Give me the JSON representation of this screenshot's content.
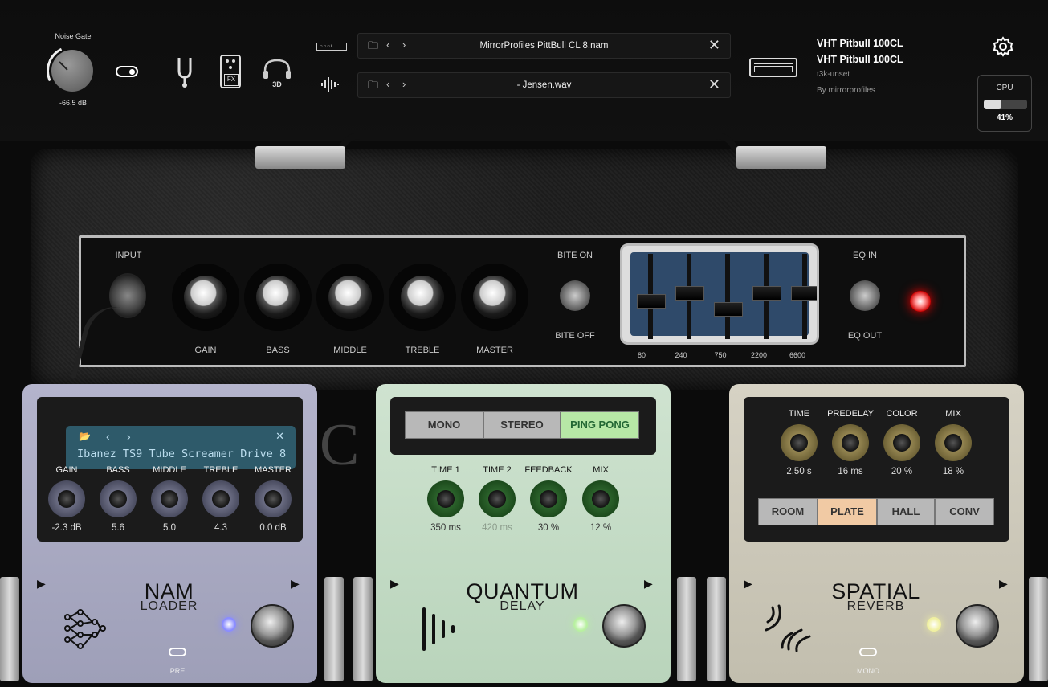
{
  "topbar": {
    "noise_gate": {
      "label": "Noise Gate",
      "value": "-66.5 dB"
    },
    "input_file": {
      "name": "MirrorProfiles PittBull CL 8.nam"
    },
    "ir_file": {
      "name": "- Jensen.wav"
    },
    "amp_info": {
      "title1": "VHT Pitbull 100CL",
      "title2": "VHT Pitbull 100CL",
      "line3": "t3k-unset",
      "line4": "By mirrorprofiles"
    },
    "three_d_label": "3D",
    "fx_label": "FX",
    "cpu": {
      "label": "CPU",
      "value": "41%",
      "fraction": 0.41
    }
  },
  "amp": {
    "input_label": "INPUT",
    "knobs": [
      "GAIN",
      "BASS",
      "MIDDLE",
      "TREBLE",
      "MASTER"
    ],
    "bite_on": "BITE ON",
    "bite_off": "BITE OFF",
    "eq_in": "EQ IN",
    "eq_out": "EQ OUT",
    "eq_freqs": [
      "80",
      "240",
      "750",
      "2200",
      "6600"
    ],
    "brand_partial": "C"
  },
  "pedals": {
    "nam": {
      "lcd": "Ibanez TS9 Tube Screamer Drive 8",
      "knobs": [
        {
          "label": "GAIN",
          "value": "-2.3 dB"
        },
        {
          "label": "BASS",
          "value": "5.6"
        },
        {
          "label": "MIDDLE",
          "value": "5.0"
        },
        {
          "label": "TREBLE",
          "value": "4.3"
        },
        {
          "label": "MASTER",
          "value": "0.0 dB"
        }
      ],
      "title": "NAM",
      "subtitle": "LOADER",
      "toggle_label": "PRE",
      "led_color": "#8a8cff"
    },
    "delay": {
      "modes": [
        "MONO",
        "STEREO",
        "PING PONG"
      ],
      "knobs": [
        {
          "label": "TIME 1",
          "value": "350 ms"
        },
        {
          "label": "TIME 2",
          "value": "420 ms"
        },
        {
          "label": "FEEDBACK",
          "value": "30 %"
        },
        {
          "label": "MIX",
          "value": "12 %"
        }
      ],
      "title": "QUANTUM",
      "subtitle": "DELAY",
      "led_color": "#b8f0a0"
    },
    "reverb": {
      "knobs": [
        {
          "label": "TIME",
          "value": "2.50 s"
        },
        {
          "label": "PREDELAY",
          "value": "16 ms"
        },
        {
          "label": "COLOR",
          "value": "20 %"
        },
        {
          "label": "MIX",
          "value": "18 %"
        }
      ],
      "modes": [
        "ROOM",
        "PLATE",
        "HALL",
        "CONV"
      ],
      "title": "SPATIAL",
      "subtitle": "REVERB",
      "toggle_label": "MONO",
      "led_color": "#f0f0a0"
    }
  }
}
